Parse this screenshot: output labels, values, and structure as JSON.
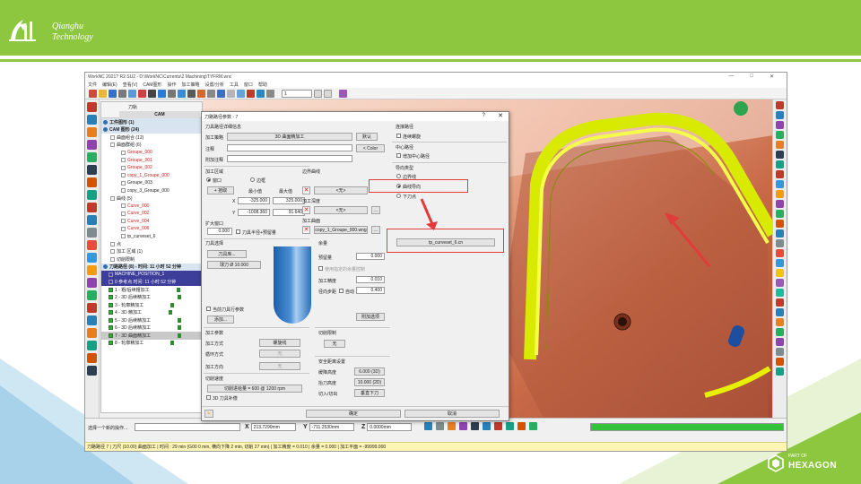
{
  "brand": {
    "company_line1": "Qianghu",
    "company_line2": "Technology",
    "partner_small": "PART OF",
    "partner_name": "HEXAGON"
  },
  "app": {
    "title": "WorkNC 2021? R2 SU2 - D:\\WorkNC\\Currents\\2 Machining\\TYFRM.wnc",
    "window_controls": [
      "—",
      "□",
      "✕"
    ],
    "menu": [
      "文件",
      "编辑(E)",
      "查看(V)",
      "CAM图形",
      "操作",
      "加工策略",
      "设置/分析",
      "工具",
      "窗口",
      "帮助"
    ],
    "toolbar_select": "1",
    "tree": {
      "tab_top": "刀轨",
      "tab_cam": "CAM",
      "rows": [
        {
          "text": "工件图形 (1)",
          "kind": "group"
        },
        {
          "text": "CAM 图形 (24)",
          "kind": "group"
        },
        {
          "text": "曲面组合 (12)",
          "kind": "node"
        },
        {
          "text": "曲面群组 (6)",
          "kind": "node"
        },
        {
          "text": "Groupe_000",
          "kind": "red"
        },
        {
          "text": "Groupe_001",
          "kind": "red"
        },
        {
          "text": "Groupe_002",
          "kind": "red"
        },
        {
          "text": "copy_1_Groupe_000",
          "kind": "red"
        },
        {
          "text": "Groupe_003",
          "kind": "leaf"
        },
        {
          "text": "copy_3_Groupe_000",
          "kind": "leaf"
        },
        {
          "text": "曲线 (5)",
          "kind": "node"
        },
        {
          "text": "Curve_000",
          "kind": "red"
        },
        {
          "text": "Curve_002",
          "kind": "red"
        },
        {
          "text": "Curve_004",
          "kind": "red"
        },
        {
          "text": "Curve_006",
          "kind": "red"
        },
        {
          "text": "tp_curveset_6",
          "kind": "leaf"
        },
        {
          "text": "点",
          "kind": "node"
        },
        {
          "text": "加工 区域 (1)",
          "kind": "node"
        },
        {
          "text": "切削限制",
          "kind": "node"
        },
        {
          "text": "刀路路径 (8) - 时间: 11 小时 52 分钟",
          "kind": "group"
        },
        {
          "text": "MACHINE_POSITION_1",
          "kind": "sel"
        },
        {
          "text": "0 参考点 时间: 11 小时 52 分钟",
          "kind": "sel"
        },
        {
          "text": "1 - 粗/后续粗加工",
          "kind": "op"
        },
        {
          "text": "2 - 3D 后续精加工",
          "kind": "op"
        },
        {
          "text": "3 - 轮廓精加工",
          "kind": "op"
        },
        {
          "text": "4 - 3D 精加工",
          "kind": "op"
        },
        {
          "text": "5 - 3D 后续精加工",
          "kind": "op"
        },
        {
          "text": "6 - 3D 后续精加工",
          "kind": "op"
        },
        {
          "text": "7 - 3D 曲面精加工",
          "kind": "opsel"
        },
        {
          "text": "8 - 轮廓精加工",
          "kind": "op"
        }
      ]
    },
    "bottom": {
      "cmd_label": "选择一个新的操作...",
      "x_label": "X",
      "x_value": "213.7290mm",
      "y_label": "Y",
      "y_value": "-711.2530mm",
      "z_label": "Z",
      "z_value": "0.0000mm",
      "progress": 1.0,
      "status": "刀路路径 7 | 刀尺 (10.00) 曲面加工 | 时间 : 29 min (G00 0 min, 横向下降 2 min, 切削 27 min) | 加工精度 = 0.010 | 余量 = 0.000 | 加工平面 = -99999.000"
    }
  },
  "dialog": {
    "title": "刀路路径参数 - 7",
    "help": "?",
    "close": "✕",
    "general_header": "刀具路径详细信息",
    "type_label": "加工策略",
    "type_value": "3D 曲面精加工",
    "default_btn": "默认",
    "comment_label": "注释",
    "color_btn": "< Color",
    "extra_comment_label": "附加注释",
    "zone_header": "加工区域",
    "zone_window": "窗口",
    "zone_frame": "边框",
    "zone_add": "+ 拾取",
    "zone_min": "最小值",
    "zone_max": "最大值",
    "x_label": "X",
    "x_min": "-325.000",
    "x_max": "325.000",
    "y_label": "Y",
    "y_min": "-1008.360",
    "y_max": "91.640",
    "extend_label": "扩大窗口",
    "extend_value": "0.000",
    "extend_chk": "刀具半径+预留量",
    "boundary_label": "边界曲线",
    "boundary_value": "<无>",
    "plane_label": "加工深度",
    "plane_value": "<无>",
    "surface_label": "加工曲面",
    "surface_value": "copy_1_Groupe_000.wng",
    "tool_header": "刀具选择",
    "tool_btn": "刀具库...",
    "tool_name": "球刀 Ø 10.000",
    "tool_chk": "当前刀具行参数",
    "tool_add": "添加...",
    "stock_header": "余量",
    "stock_label": "预留量",
    "stock_value": "0.000",
    "stock_chk": "使用指定的余量控制",
    "tol_label": "加工精度",
    "tol_value": "0.010",
    "step_label": "径向步距",
    "step_chk": "自动",
    "step_value": "0.400",
    "adv_btn": "附加选项",
    "path_header": "加工参数",
    "mode_label": "加工方式",
    "mode_value": "螺旋线",
    "loop_label": "循环方式",
    "loop_value": "无",
    "dir_label": "加工方向",
    "dir_value": "无",
    "speed_header": "切削速度",
    "speed_value": "切削进给量 = 600 @ 1200 rpm",
    "speed_chk": "3D 刀具补偿",
    "limit_header": "切削限制",
    "limit_value": "无",
    "safe_header": "安全距离设置",
    "safe_label": "缓降高度",
    "safe_value": "6.000 (3D)",
    "retract_label": "抬刀高度",
    "retract_value": "10.000 (2D)",
    "lead_label": "切入/切出",
    "lead_btn": "垂直下刀",
    "side_header": "连接路径",
    "side_chk": "连续螺旋",
    "center_header": "中心路径",
    "center_chk": "增加中心路径",
    "orient_header": "导向类型",
    "orient_opt1": "边界线",
    "orient_opt2": "曲线导向",
    "orient_opt3": "下刀点",
    "curve_value": "tp_curveset_6.cn",
    "ok_btn": "确定",
    "cancel_btn": "取消"
  },
  "colors": {
    "brand_green": "#8dc63f",
    "highlight_red": "#e23b3b",
    "toolpath_yellow": "#e6f000",
    "selection_blue": "#3d3d9a"
  }
}
